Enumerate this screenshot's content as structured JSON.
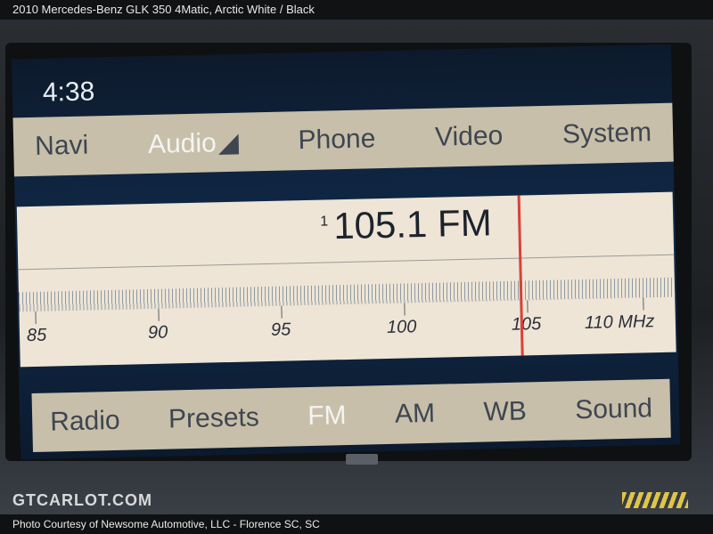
{
  "header": {
    "text": "2010 Mercedes-Benz GLK 350 4Matic,  Arctic White / Black"
  },
  "screen": {
    "clock": "4:38",
    "main_menu": [
      {
        "label": "Navi",
        "active": false
      },
      {
        "label": "Audio",
        "active": true
      },
      {
        "label": "Phone",
        "active": false
      },
      {
        "label": "Video",
        "active": false
      },
      {
        "label": "System",
        "active": false
      }
    ],
    "tuner": {
      "preset_number": "1",
      "frequency": "105.1 FM",
      "scale_labels": [
        "85",
        "90",
        "95",
        "100",
        "105",
        "110 MHz"
      ],
      "needle_position_mhz": 105.1
    },
    "softkeys": [
      {
        "label": "Radio",
        "active": false
      },
      {
        "label": "Presets",
        "active": false
      },
      {
        "label": "FM",
        "active": true
      },
      {
        "label": "AM",
        "active": false
      },
      {
        "label": "WB",
        "active": false
      },
      {
        "label": "Sound",
        "active": false
      }
    ]
  },
  "watermark": "GTCARLOT.COM",
  "footer": {
    "text": "Photo Courtesy of Newsome Automotive, LLC - Florence SC, SC"
  }
}
